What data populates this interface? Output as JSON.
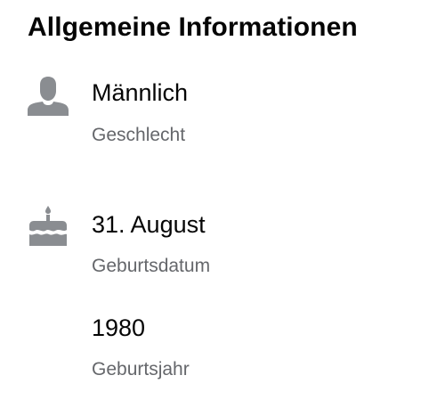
{
  "section": {
    "title": "Allgemeine Informationen"
  },
  "items": [
    {
      "icon": "person-icon",
      "value": "Männlich",
      "label": "Geschlecht"
    },
    {
      "icon": "birthday-cake-icon",
      "value": "31. August",
      "label": "Geburtsdatum"
    },
    {
      "icon": "",
      "value": "1980",
      "label": "Geburtsjahr"
    }
  ],
  "colors": {
    "text_primary": "#050505",
    "text_secondary": "#65676b",
    "icon": "#8a8d91"
  }
}
